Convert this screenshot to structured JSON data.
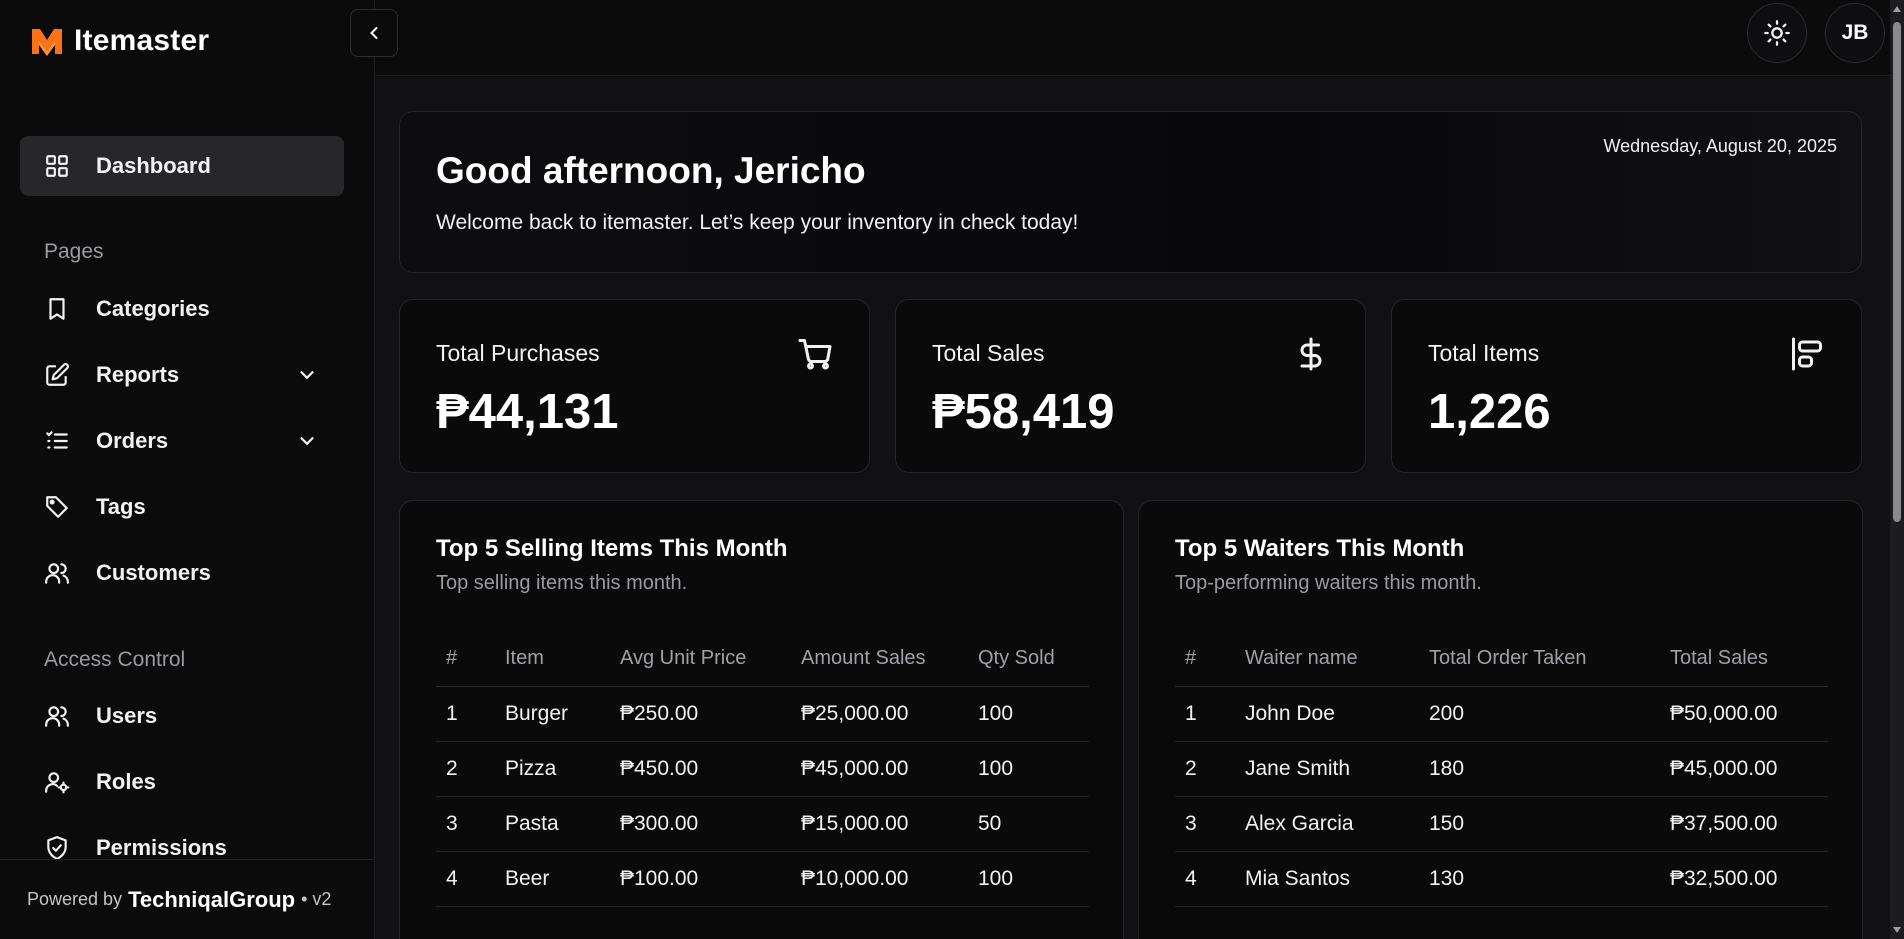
{
  "brand": {
    "name": "Itemaster",
    "accent": "#f97316"
  },
  "sidebar": {
    "dashboard": {
      "label": "Dashboard",
      "icon": "grid-icon"
    },
    "pages_label": "Pages",
    "pages": [
      {
        "label": "Categories",
        "icon": "bookmark-icon"
      },
      {
        "label": "Reports",
        "icon": "edit-icon",
        "expandable": true
      },
      {
        "label": "Orders",
        "icon": "list-icon",
        "expandable": true
      },
      {
        "label": "Tags",
        "icon": "tag-icon"
      },
      {
        "label": "Customers",
        "icon": "users-icon"
      }
    ],
    "access_label": "Access Control",
    "access": [
      {
        "label": "Users",
        "icon": "users-icon"
      },
      {
        "label": "Roles",
        "icon": "user-cog-icon"
      },
      {
        "label": "Permissions",
        "icon": "shield-check-icon"
      }
    ],
    "footer": {
      "prefix": "Powered by",
      "company": "TechniqalGroup",
      "version": "• v2"
    }
  },
  "topbar": {
    "avatar_initials": "JB"
  },
  "welcome": {
    "greeting": "Good afternoon, Jericho",
    "subtitle": "Welcome back to itemaster. Let’s keep your inventory in check today!",
    "date": "Wednesday, August 20, 2025"
  },
  "stats": [
    {
      "label": "Total Purchases",
      "value": "₱44,131",
      "icon": "cart-icon"
    },
    {
      "label": "Total Sales",
      "value": "₱58,419",
      "icon": "dollar-icon"
    },
    {
      "label": "Total Items",
      "value": "1,226",
      "icon": "align-start-icon"
    }
  ],
  "top_items": {
    "title": "Top 5 Selling Items This Month",
    "subtitle": "Top selling items this month.",
    "columns": [
      "#",
      "Item",
      "Avg Unit Price",
      "Amount Sales",
      "Qty Sold"
    ],
    "rows": [
      [
        "1",
        "Burger",
        "₱250.00",
        "₱25,000.00",
        "100"
      ],
      [
        "2",
        "Pizza",
        "₱450.00",
        "₱45,000.00",
        "100"
      ],
      [
        "3",
        "Pasta",
        "₱300.00",
        "₱15,000.00",
        "50"
      ],
      [
        "4",
        "Beer",
        "₱100.00",
        "₱10,000.00",
        "100"
      ]
    ]
  },
  "top_waiters": {
    "title": "Top 5 Waiters This Month",
    "subtitle": "Top-performing waiters this month.",
    "columns": [
      "#",
      "Waiter name",
      "Total Order Taken",
      "Total Sales"
    ],
    "rows": [
      [
        "1",
        "John Doe",
        "200",
        "₱50,000.00"
      ],
      [
        "2",
        "Jane Smith",
        "180",
        "₱45,000.00"
      ],
      [
        "3",
        "Alex Garcia",
        "150",
        "₱37,500.00"
      ],
      [
        "4",
        "Mia Santos",
        "130",
        "₱32,500.00"
      ]
    ]
  }
}
